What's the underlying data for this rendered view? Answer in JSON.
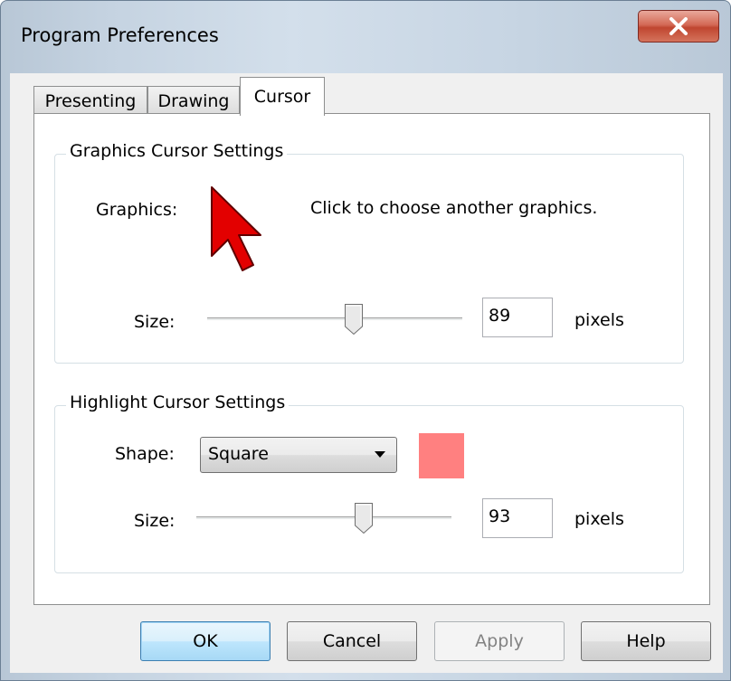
{
  "window": {
    "title": "Program Preferences",
    "close_glyph": "X"
  },
  "tabs": [
    {
      "label": "Presenting",
      "active": false
    },
    {
      "label": "Drawing",
      "active": false
    },
    {
      "label": "Cursor",
      "active": true
    }
  ],
  "graphics_group": {
    "title": "Graphics Cursor Settings",
    "graphics_label": "Graphics:",
    "cursor_icon": "red-arrow-cursor-icon",
    "cursor_color": "#e30000",
    "hint": "Click to choose another graphics.",
    "size_label": "Size:",
    "size_value": "89",
    "size_slider_fraction": 0.58,
    "unit": "pixels"
  },
  "highlight_group": {
    "title": "Highlight Cursor Settings",
    "shape_label": "Shape:",
    "shape_value": "Square",
    "highlight_color": "#ff8080",
    "size_label": "Size:",
    "size_value": "93",
    "size_slider_fraction": 0.67,
    "unit": "pixels"
  },
  "buttons": {
    "ok": "OK",
    "cancel": "Cancel",
    "apply": "Apply",
    "help": "Help"
  }
}
